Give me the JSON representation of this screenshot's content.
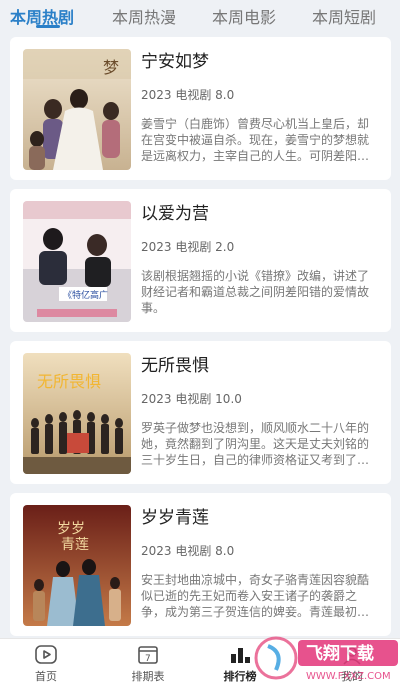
{
  "tabs": [
    {
      "label": "本周热剧",
      "active": true
    },
    {
      "label": "本周热漫",
      "active": false
    },
    {
      "label": "本周电影",
      "active": false
    },
    {
      "label": "本周短剧",
      "active": false
    }
  ],
  "cards": [
    {
      "title": "宁安如梦",
      "meta": "2023 电视剧 8.0",
      "desc": "姜雪宁（白鹿饰）曾费尽心机当上皇后，却在宫变中被逼自杀。现在，姜雪宁的梦想就是远离权力，主宰自己的人生。可阴差阳错她还是入宫做了伴读…",
      "poster_colors": [
        "#e9dcc3",
        "#c9b79a"
      ]
    },
    {
      "title": "以爱为营",
      "meta": "2023 电视剧 2.0",
      "desc": "该剧根据翘摇的小说《错撩》改编，讲述了财经记者和霸道总裁之间阴差阳错的爱情故事。",
      "poster_colors": [
        "#f3e6e8",
        "#c98f9a"
      ]
    },
    {
      "title": "无所畏惧",
      "meta": "2023 电视剧 10.0",
      "desc": "罗英子做梦也没想到，顺风顺水二十八年的她，竟然翻到了阴沟里。这天是丈夫刘铭的三十岁生日，自己的律师资格证又考到了手，本以为是个好日子，…",
      "poster_colors": [
        "#ecd7b0",
        "#a9885a"
      ]
    },
    {
      "title": "岁岁青莲",
      "meta": "2023 电视剧 8.0",
      "desc": "安王封地曲凉城中，奇女子骆青莲因容貌酷似已逝的先王妃而卷入安王诸子的袭爵之争，成为第三子贺连信的婢妾。青莲最初一心要逃离，后与贺连信历…",
      "poster_colors": [
        "#7a2a20",
        "#c26a3a"
      ]
    }
  ],
  "bottom_nav": [
    {
      "label": "首页",
      "icon": "play-icon",
      "active": false
    },
    {
      "label": "排期表",
      "icon": "calendar-icon",
      "active": false
    },
    {
      "label": "排行榜",
      "icon": "ranking-icon",
      "active": true
    },
    {
      "label": "我的",
      "icon": "user-icon",
      "active": false
    }
  ],
  "calendar_day": "7",
  "watermark": {
    "text": "飞翔下载",
    "url": "WWW.FXXZ.COM"
  },
  "accent": "#2b80c8"
}
